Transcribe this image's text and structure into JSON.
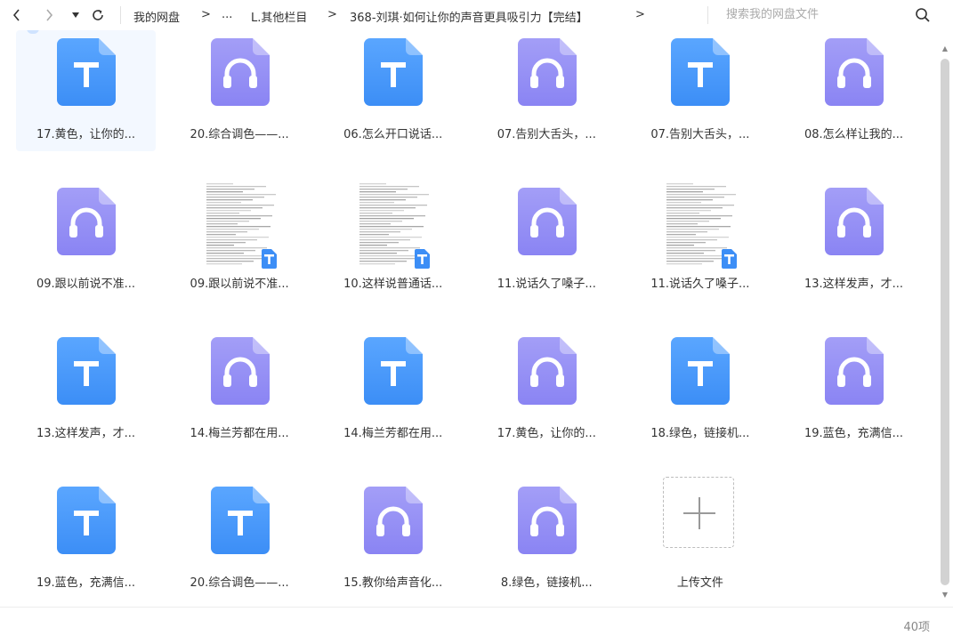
{
  "toolbar": {
    "back_icon": "chevron-left-icon",
    "forward_icon": "chevron-right-icon",
    "dropdown_icon": "caret-down-icon",
    "refresh_icon": "refresh-icon"
  },
  "breadcrumb": {
    "items": [
      "我的网盘",
      "...",
      "L.其他栏目",
      "368-刘琪·如何让你的声音更具吸引力【完结】"
    ],
    "separator": ">"
  },
  "search": {
    "placeholder": "搜索我的网盘文件",
    "icon": "search-icon"
  },
  "colors": {
    "text_file": "#3c8ef6",
    "text_file_light": "#5aa6ff",
    "audio_file": "#8a84f3",
    "audio_file_light": "#a39ef7",
    "selected_bg": "#f3f8ff"
  },
  "files": [
    {
      "name": "17.黄色，让你的...",
      "type": "text",
      "selected": true
    },
    {
      "name": "20.综合调色——...",
      "type": "audio"
    },
    {
      "name": "06.怎么开口说话...",
      "type": "text"
    },
    {
      "name": "07.告别大舌头，...",
      "type": "audio"
    },
    {
      "name": "07.告别大舌头，...",
      "type": "text"
    },
    {
      "name": "08.怎么样让我的...",
      "type": "audio"
    },
    {
      "name": "09.跟以前说不准...",
      "type": "audio"
    },
    {
      "name": "09.跟以前说不准...",
      "type": "doc"
    },
    {
      "name": "10.这样说普通话...",
      "type": "doc"
    },
    {
      "name": "11.说话久了嗓子...",
      "type": "audio"
    },
    {
      "name": "11.说话久了嗓子...",
      "type": "doc"
    },
    {
      "name": "13.这样发声，才...",
      "type": "audio"
    },
    {
      "name": "13.这样发声，才...",
      "type": "text"
    },
    {
      "name": "14.梅兰芳都在用...",
      "type": "audio"
    },
    {
      "name": "14.梅兰芳都在用...",
      "type": "text"
    },
    {
      "name": "17.黄色，让你的...",
      "type": "audio"
    },
    {
      "name": "18.绿色，链接机...",
      "type": "text"
    },
    {
      "name": "19.蓝色，充满信...",
      "type": "audio"
    },
    {
      "name": "19.蓝色，充满信...",
      "type": "text"
    },
    {
      "name": "20.综合调色——...",
      "type": "text"
    },
    {
      "name": "15.教你给声音化...",
      "type": "audio"
    },
    {
      "name": "8.绿色，链接机...",
      "type": "audio"
    }
  ],
  "upload": {
    "label": "上传文件",
    "icon": "plus-icon"
  },
  "footer": {
    "count": "40项"
  }
}
